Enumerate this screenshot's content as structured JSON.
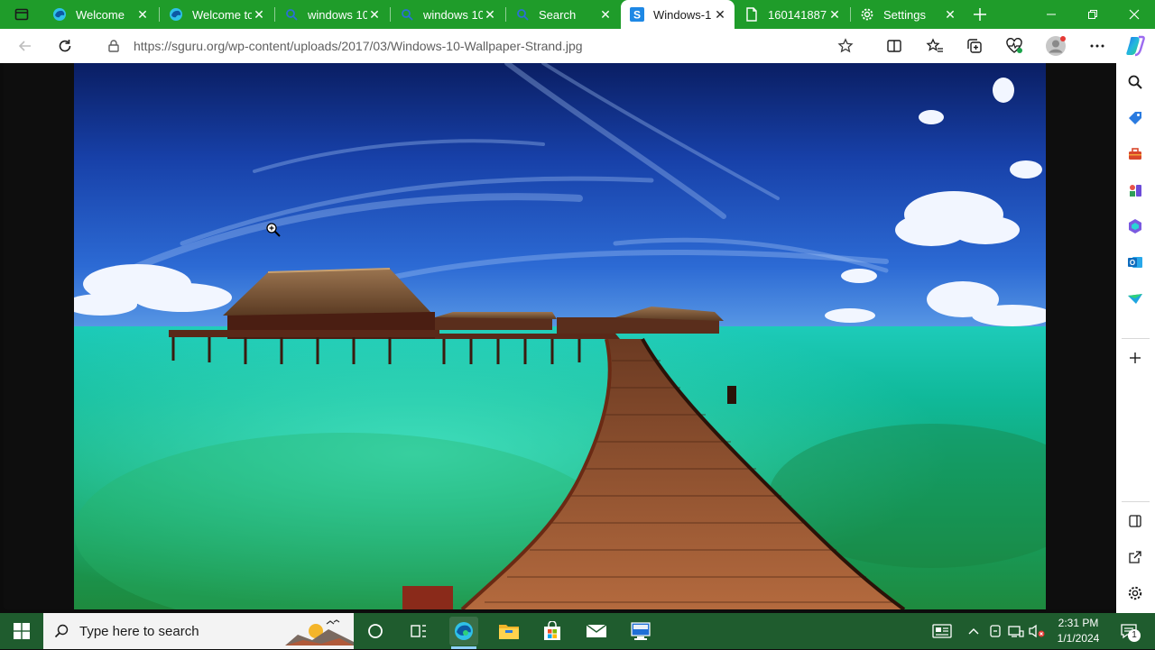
{
  "tabs": [
    {
      "title": "Welcome",
      "icon": "edge-icon"
    },
    {
      "title": "Welcome to",
      "icon": "edge-icon"
    },
    {
      "title": "windows 10",
      "icon": "search-icon"
    },
    {
      "title": "windows 10",
      "icon": "search-icon"
    },
    {
      "title": "Search",
      "icon": "search-icon"
    },
    {
      "title": "Windows-1",
      "icon": "s-site-icon",
      "active": true
    },
    {
      "title": "160141887",
      "icon": "document-icon"
    },
    {
      "title": "Settings",
      "icon": "gear-icon"
    }
  ],
  "address_bar": {
    "url": "https://sguru.org/wp-content/uploads/2017/03/Windows-10-Wallpaper-Strand.jpg"
  },
  "taskbar": {
    "search_placeholder": "Type here to search",
    "time": "2:31 PM",
    "date": "1/1/2024",
    "notification_count": "1"
  },
  "colors": {
    "tab_strip": "#1f9c2a",
    "taskbar": "#1f5c2e",
    "accent_blue": "#1a73e8"
  }
}
